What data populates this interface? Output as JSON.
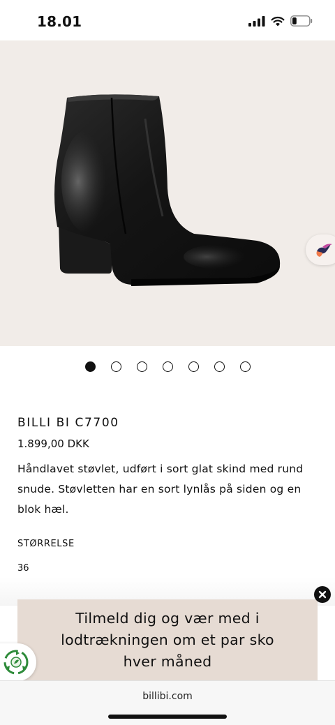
{
  "status_bar": {
    "time": "18.01",
    "battery_level": 0.25
  },
  "gallery": {
    "slide_count": 7,
    "active_index": 0
  },
  "product": {
    "title": "BILLI BI C7700",
    "price": "1.899,00 DKK",
    "description": "Håndlavet støvlet, udført i sort glat skind med rund snude. Støvletten har en sort lynlås på siden og en blok hæl.",
    "size_label": "STØRRELSE",
    "size_value": "36"
  },
  "banner": {
    "text": "Tilmeld dig og vær med i lodtrækningen om et par sko hver måned"
  },
  "browser": {
    "url": "billibi.com"
  },
  "colors": {
    "gallery_bg": "#f1ece8",
    "banner_bg": "#e6dbd3",
    "text": "#111111"
  }
}
